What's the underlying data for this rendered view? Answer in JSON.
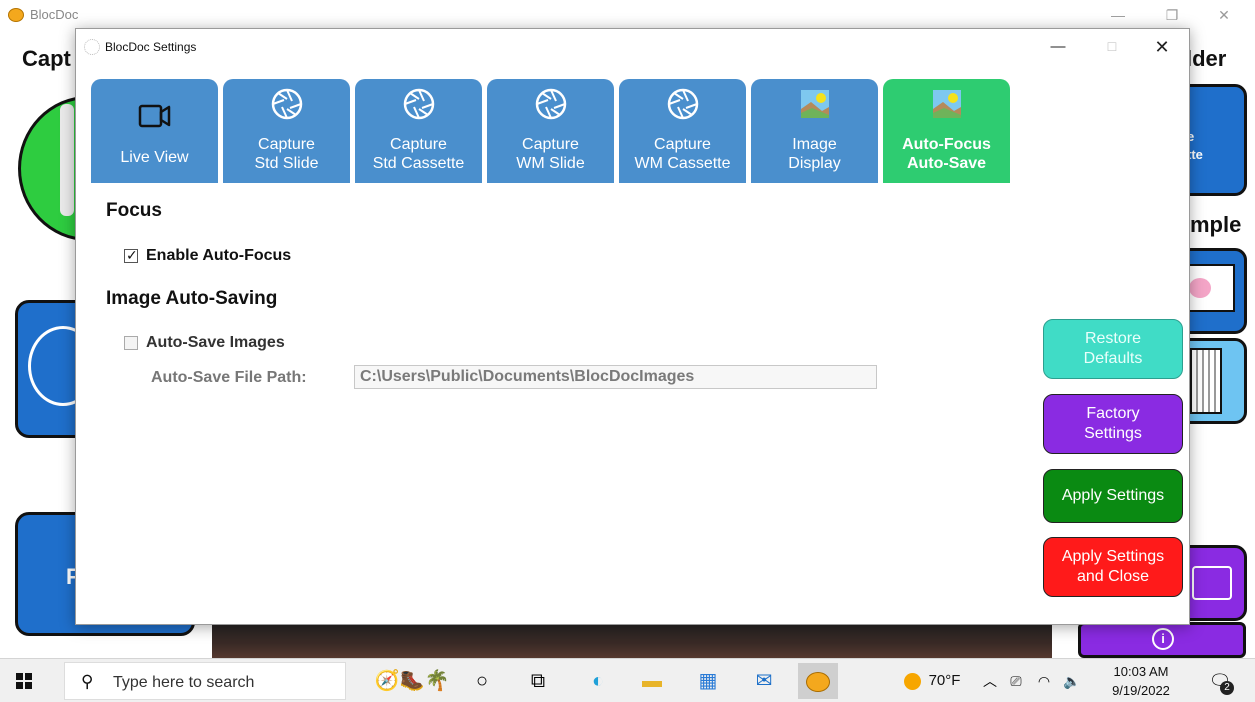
{
  "background_app": {
    "title": "BlocDoc",
    "heading_left": "Capt",
    "heading_right": "lder",
    "heading_right2": "mple",
    "tile_right_text": "e\ntte",
    "tile_left_char": "F"
  },
  "dialog": {
    "title": "BlocDoc Settings",
    "tabs": [
      {
        "label": "Live View",
        "icon": "video-camera-icon"
      },
      {
        "label": "Capture\nStd Slide",
        "icon": "aperture-icon"
      },
      {
        "label": "Capture\nStd Cassette",
        "icon": "aperture-icon"
      },
      {
        "label": "Capture\nWM Slide",
        "icon": "aperture-icon"
      },
      {
        "label": "Capture\nWM Cassette",
        "icon": "aperture-icon"
      },
      {
        "label": "Image\nDisplay",
        "icon": "image-icon"
      },
      {
        "label": "Auto-Focus\nAuto-Save",
        "icon": "image-icon",
        "active": true
      }
    ],
    "focus": {
      "heading": "Focus",
      "enable_autofocus_label": "Enable Auto-Focus",
      "enable_autofocus_checked": true
    },
    "saving": {
      "heading": "Image Auto-Saving",
      "autosave_label": "Auto-Save Images",
      "autosave_checked": false,
      "path_label": "Auto-Save File Path:",
      "path_value": "C:\\Users\\Public\\Documents\\BlocDocImages"
    },
    "buttons": {
      "restore": "Restore\nDefaults",
      "factory": "Factory\nSettings",
      "apply": "Apply Settings",
      "apply_close": "Apply Settings\nand Close"
    }
  },
  "taskbar": {
    "search_placeholder": "Type here to search",
    "weather": "70°F",
    "time": "10:03 AM",
    "date": "9/19/2022",
    "notification_count": "2"
  },
  "colors": {
    "tab_blue": "#4a8fcd",
    "tab_active_green": "#2ecc71",
    "restore_teal": "#40dcc6",
    "factory_purple": "#8a2be2",
    "apply_green": "#0a8a12",
    "apply_close_red": "#ff1a1a"
  }
}
